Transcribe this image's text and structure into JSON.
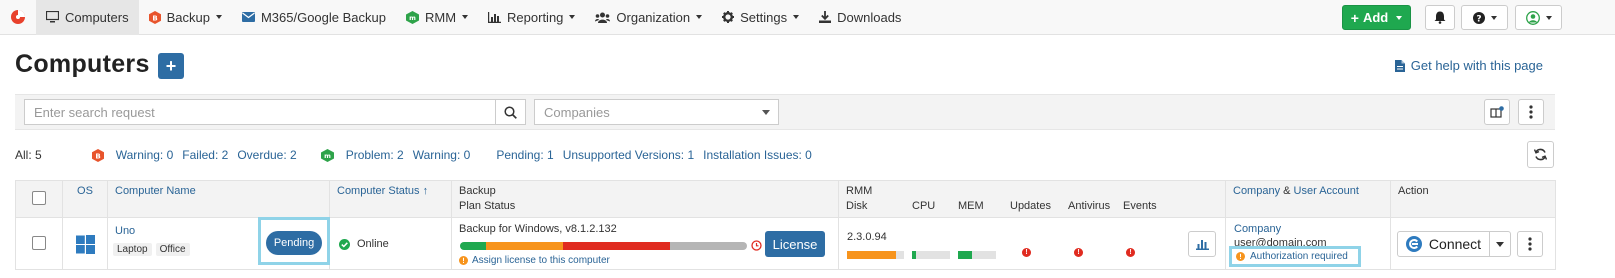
{
  "nav": {
    "items": [
      {
        "label": "Computers",
        "icon": "monitor-icon"
      },
      {
        "label": "Backup",
        "icon": "backup-icon"
      },
      {
        "label": "M365/Google Backup",
        "icon": "mail-icon"
      },
      {
        "label": "RMM",
        "icon": "rmm-icon"
      },
      {
        "label": "Reporting",
        "icon": "chart-icon"
      },
      {
        "label": "Organization",
        "icon": "users-icon"
      },
      {
        "label": "Settings",
        "icon": "gear-icon"
      },
      {
        "label": "Downloads",
        "icon": "download-icon"
      }
    ],
    "add_label": "Add"
  },
  "page": {
    "title": "Computers",
    "help": "Get help with this page"
  },
  "filter": {
    "search_placeholder": "Enter search request",
    "companies_placeholder": "Companies"
  },
  "stats": {
    "all": "All: 5",
    "backup": [
      "Warning: 0",
      "Failed: 2",
      "Overdue: 2"
    ],
    "rmm": [
      "Problem: 2",
      "Warning: 0"
    ],
    "other": [
      "Pending: 1",
      "Unsupported Versions: 1",
      "Installation Issues: 0"
    ]
  },
  "table": {
    "headers": {
      "os": "OS",
      "computer_name": "Computer Name",
      "computer_status": "Computer Status",
      "backup": "Backup",
      "plan_status": "Plan Status",
      "rmm": "RMM",
      "disk": "Disk",
      "cpu": "CPU",
      "mem": "MEM",
      "updates": "Updates",
      "antivirus": "Antivirus",
      "events": "Events",
      "company": "Company",
      "amp": " & ",
      "user_account": "User Account",
      "action": "Action"
    },
    "row": {
      "name": "Uno",
      "tags": [
        "Laptop",
        "Office"
      ],
      "pending": "Pending",
      "status": "Online",
      "backup_version": "Backup for Windows, v8.1.2.132",
      "plan_bar": [
        0.09,
        0.27,
        0.37,
        0.27
      ],
      "license": "License",
      "assign_license": "Assign license to this computer",
      "rmm_version": "2.3.0.94",
      "disk_fill": 0.86,
      "cpu_fill": 0.1,
      "mem_fill": 0.38,
      "company": "Company",
      "user": "user@domain.com",
      "auth": "Authorization required",
      "connect": "Connect"
    }
  },
  "colors": {
    "accent": "#2e6da4",
    "green": "#1fa84f",
    "red": "#e02b20",
    "orange": "#f7941d",
    "link": "#2a6496"
  }
}
